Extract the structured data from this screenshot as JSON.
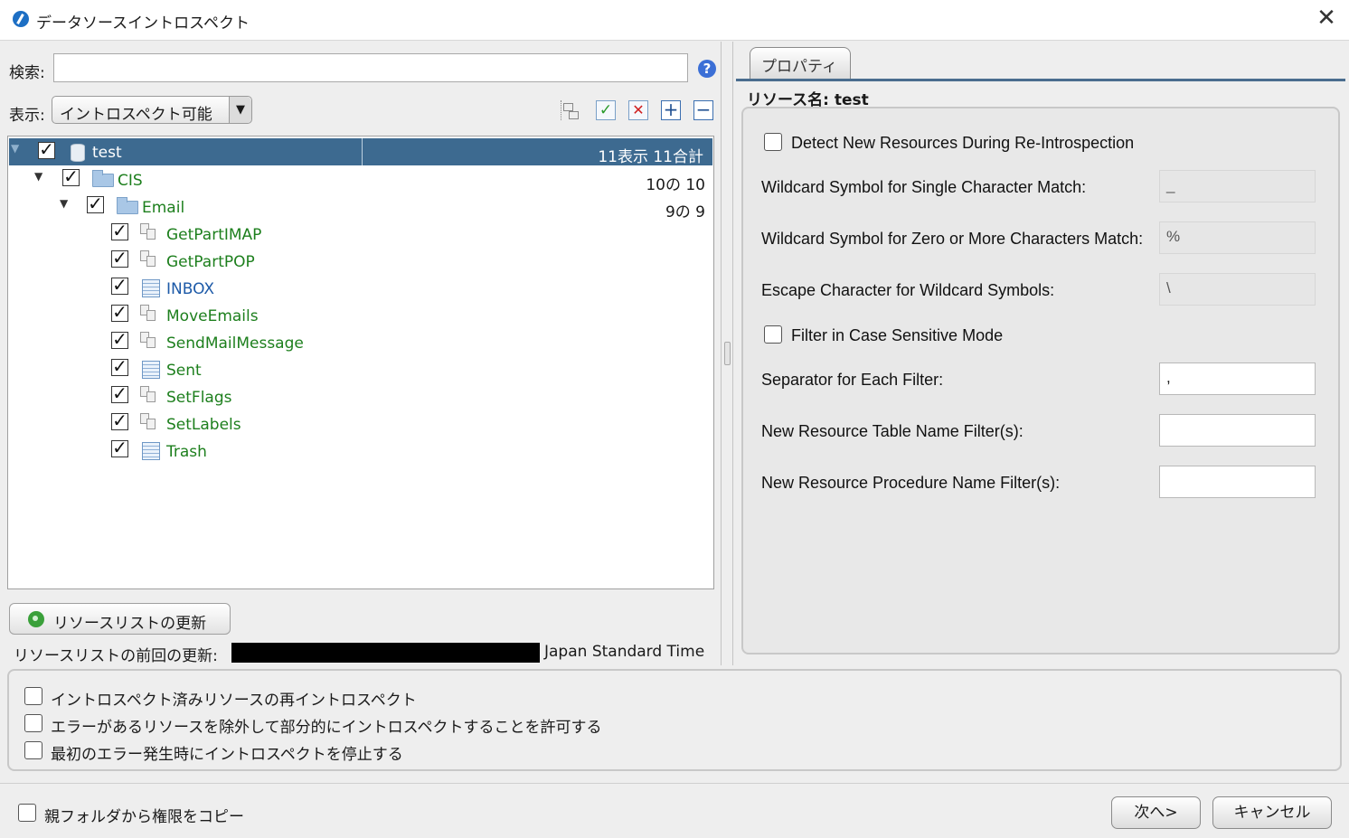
{
  "window": {
    "title": "データソースイントロスペクト",
    "close_glyph": "✕"
  },
  "search": {
    "label": "検索:",
    "value": "",
    "help_glyph": "?"
  },
  "view": {
    "label": "表示:",
    "selected": "イントロスペクト可能",
    "arrow": "▼"
  },
  "toolbar": {
    "check_all_glyph": "✓",
    "uncheck_all_glyph": "✕",
    "expand_glyph": "+",
    "collapse_glyph": "−"
  },
  "tree": {
    "root": {
      "label": "test",
      "count": "11表示 11合計",
      "checked": true
    },
    "cis": {
      "label": "CIS",
      "count": "10の 10",
      "checked": true
    },
    "email": {
      "label": "Email",
      "count": "9の 9",
      "checked": true
    },
    "items": [
      {
        "label": "GetPartIMAP",
        "type": "procedure",
        "checked": true
      },
      {
        "label": "GetPartPOP",
        "type": "procedure",
        "checked": true
      },
      {
        "label": "INBOX",
        "type": "table",
        "checked": true
      },
      {
        "label": "MoveEmails",
        "type": "procedure",
        "checked": true
      },
      {
        "label": "SendMailMessage",
        "type": "procedure",
        "checked": true
      },
      {
        "label": "Sent",
        "type": "table",
        "checked": true
      },
      {
        "label": "SetFlags",
        "type": "procedure",
        "checked": true
      },
      {
        "label": "SetLabels",
        "type": "procedure",
        "checked": true
      },
      {
        "label": "Trash",
        "type": "table",
        "checked": true
      }
    ],
    "check_glyph": "✓",
    "expanded_glyph": "▼"
  },
  "refresh": {
    "label": "リソースリストの更新"
  },
  "last_update": {
    "label": "リソースリストの前回の更新:",
    "timezone": "Japan Standard Time"
  },
  "properties": {
    "tab": "プロパティ",
    "resource_name": "リソース名: test",
    "detect_new": "Detect New Resources During Re-Introspection",
    "wildcard_single_label": "Wildcard Symbol for Single Character Match:",
    "wildcard_single_value": "_",
    "wildcard_multi_label": "Wildcard Symbol for Zero or More Characters Match:",
    "wildcard_multi_value": "%",
    "escape_label": "Escape Character for Wildcard Symbols:",
    "escape_value": "\\",
    "case_sensitive": "Filter in Case Sensitive Mode",
    "separator_label": "Separator for Each Filter:",
    "separator_value": ",",
    "table_filter_label": "New Resource Table Name Filter(s):",
    "table_filter_value": "",
    "proc_filter_label": "New Resource Procedure Name Filter(s):",
    "proc_filter_value": ""
  },
  "options": [
    "イントロスペクト済みリソースの再イントロスペクト",
    "エラーがあるリソースを除外して部分的にイントロスペクトすることを許可する",
    "最初のエラー発生時にイントロスペクトを停止する"
  ],
  "footer": {
    "copy_permissions": "親フォルダから権限をコピー",
    "next": "次へ>",
    "cancel": "キャンセル"
  }
}
